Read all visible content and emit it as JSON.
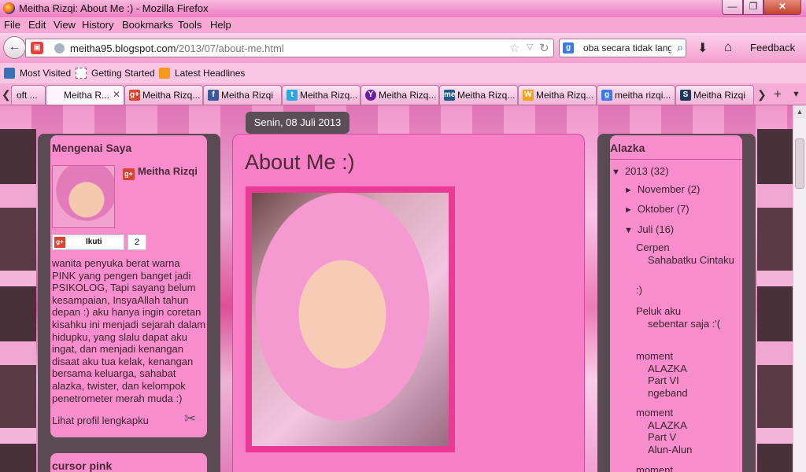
{
  "window": {
    "title": "Meitha Rizqi: About Me :) - Mozilla Firefox"
  },
  "menu": [
    "File",
    "Edit",
    "View",
    "History",
    "Bookmarks",
    "Tools",
    "Help"
  ],
  "nav": {
    "url_domain": "meitha95.blogspot.com",
    "url_path": "/2013/07/about-me.html",
    "search_text": "oba secara tidak lang",
    "feedback_label": "Feedback"
  },
  "bookmarks": [
    "Most Visited",
    "Getting Started",
    "Latest Headlines"
  ],
  "tabs": [
    {
      "label": "oft ...",
      "icon": "office-icon"
    },
    {
      "label": "Meitha R...",
      "icon": "blogger-icon",
      "active": true
    },
    {
      "label": "Meitha Rizq...",
      "icon": "google-plus-icon"
    },
    {
      "label": "Meitha Rizqi",
      "icon": "facebook-icon"
    },
    {
      "label": "Meitha Rizq...",
      "icon": "twitter-icon"
    },
    {
      "label": "Meitha Rizq...",
      "icon": "yahoo-icon"
    },
    {
      "label": "Meitha Rizq...",
      "icon": "me-icon"
    },
    {
      "label": "Meitha Rizq...",
      "icon": "wattpad-icon"
    },
    {
      "label": "meitha rizqi...",
      "icon": "google-search-icon"
    },
    {
      "label": "Meitha Rizqi",
      "icon": "s-icon"
    }
  ],
  "page": {
    "date_header": "Senin, 08 Juli 2013",
    "left": {
      "widget_title": "Mengenai Saya",
      "author_name": "Meitha Rizqi",
      "follow_label": "Ikuti",
      "follow_count": "2",
      "about": "wanita penyuka berat warna PINK yang pengen banget jadi PSIKOLOG, Tapi sayang belum kesampaian, InsyaAllah tahun depan :) aku hanya ingin coretan kisahku ini menjadi sejarah dalam hidupku, yang slalu dapat aku ingat, dan menjadi kenangan disaat aku tua kelak, kenangan bersama keluarga, sahabat alazka, twister, dan kelompok penetrometer merah muda :)",
      "profile_link": "Lihat profil lengkapku",
      "widget2_title": "cursor pink"
    },
    "post": {
      "title": "About Me :)"
    },
    "right": {
      "widget_title": "Alazka",
      "archive": [
        {
          "tri": "▼",
          "label": "2013 (32)"
        },
        {
          "tri": "►",
          "label": "November (2)"
        },
        {
          "tri": "►",
          "label": "Oktober (7)"
        },
        {
          "tri": "▼",
          "label": "Juli (16)"
        }
      ],
      "posts": [
        {
          "first": "Cerpen",
          "cont": "Sahabatku Cintaku"
        },
        {
          "first": ":)",
          "cont": ""
        },
        {
          "first": "Peluk aku",
          "cont": "sebentar saja :'("
        },
        {
          "first": "moment",
          "cont": "ALAZKA Part VI ngeband"
        },
        {
          "first": "moment",
          "cont": "ALAZKA Part V Alun-Alun"
        },
        {
          "first": "moment",
          "cont": ""
        }
      ]
    }
  },
  "colors": {
    "panel_pink": "#f78dcd",
    "frame_dark": "#5a4a52",
    "photo_frame": "#ea3a95"
  }
}
